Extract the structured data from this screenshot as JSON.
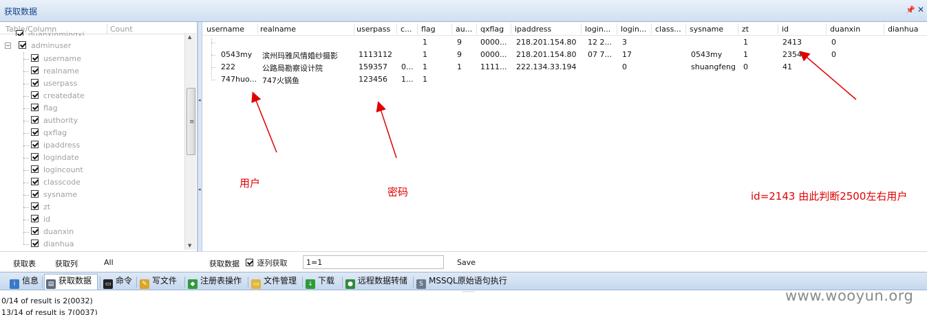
{
  "window": {
    "title": "获取数据"
  },
  "left_panel": {
    "header": {
      "col1": "Table/Column",
      "col2": "Count"
    },
    "partial_item": "duanxinmingxi",
    "table": "adminuser",
    "columns": [
      "username",
      "realname",
      "userpass",
      "createdate",
      "flag",
      "authority",
      "qxflag",
      "ipaddress",
      "logindate",
      "logincount",
      "classcode",
      "sysname",
      "zt",
      "id",
      "duanxin",
      "dianhua"
    ]
  },
  "grid": {
    "headers": [
      "username",
      "realname",
      "userpass",
      "c...",
      "flag",
      "au...",
      "qxflag",
      "ipaddress",
      "login...",
      "login...",
      "class...",
      "sysname",
      "zt",
      "id",
      "duanxin",
      "dianhua"
    ],
    "rows": [
      [
        "",
        "",
        "",
        "",
        "1",
        "9",
        "0000...",
        "218.201.154.80",
        "12 2...",
        "3",
        "",
        "",
        "1",
        "2413",
        "0",
        ""
      ],
      [
        "0543my",
        "滨州玛雅风情婚纱摄影",
        "1113112",
        "",
        "1",
        "9",
        "0000...",
        "218.201.154.80",
        "07  7...",
        "17",
        "",
        "0543my",
        "1",
        "2354",
        "0",
        ""
      ],
      [
        "222",
        "公路局勘察设计院",
        "159357",
        "0...",
        "1",
        "1",
        "1111...",
        "222.134.33.194",
        "",
        "0",
        "",
        "shuangfeng",
        "0",
        "41",
        "",
        ""
      ],
      [
        "747huo...",
        "747火锅鱼",
        "123456",
        "1...",
        "1",
        "",
        "",
        "",
        "",
        "",
        "",
        "",
        "",
        "",
        "",
        ""
      ]
    ]
  },
  "annotations": {
    "user": "用户",
    "password": "密码",
    "id_note": "id=2143 由此判断2500左右用户",
    "color": "#e00000"
  },
  "left_buttons": {
    "get_tables": "获取表",
    "get_columns": "获取列",
    "all": "All"
  },
  "query_bar": {
    "get_data": "获取数据",
    "by_column_label": "逐列获取",
    "by_column_checked": true,
    "where_value": "1=1",
    "save": "Save"
  },
  "tabs": [
    {
      "label": "信息",
      "icon": "info-icon"
    },
    {
      "label": "获取数据",
      "icon": "database-icon"
    },
    {
      "label": "命令",
      "icon": "terminal-icon"
    },
    {
      "label": "写文件",
      "icon": "write-file-icon"
    },
    {
      "label": "注册表操作",
      "icon": "registry-icon"
    },
    {
      "label": "文件管理",
      "icon": "folder-icon"
    },
    {
      "label": "下载",
      "icon": "download-icon"
    },
    {
      "label": "远程数据转储",
      "icon": "globe-icon"
    },
    {
      "label": "MSSQL原始语句执行",
      "icon": "sql-icon"
    }
  ],
  "log": {
    "lines": [
      "0/14 of result is 2(0032)",
      "13/14 of result is 7(0037)"
    ]
  },
  "watermark": "www.wooyun.org"
}
